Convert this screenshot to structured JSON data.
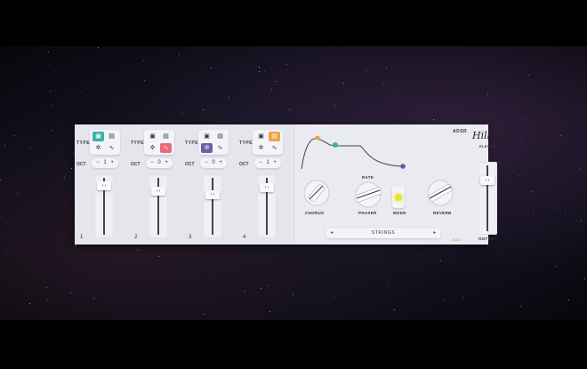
{
  "plugin": {
    "type_label": "TYPE",
    "oct_label": "OCT",
    "channels": [
      {
        "number": "1",
        "oct_value": "1",
        "type_selected_color": "#36b4a5",
        "oct_minus": "−",
        "oct_plus": "+"
      },
      {
        "number": "2",
        "oct_value": "0",
        "type_selected_color": "#e86b7a",
        "oct_minus": "−",
        "oct_plus": "+"
      },
      {
        "number": "3",
        "oct_value": "0",
        "type_selected_color": "#6d60a8",
        "oct_minus": "−",
        "oct_plus": "+"
      },
      {
        "number": "4",
        "oct_value": "1",
        "type_selected_color": "#f0a24a",
        "oct_minus": "−",
        "oct_plus": "+"
      }
    ],
    "adsr_label": "ADSR",
    "logo_script": "Hillman",
    "logo_sub": "ELEVNA",
    "knobs": {
      "chorus": "CHORUS",
      "phaser": "PHASER",
      "rate": "RATE",
      "mode": "MODE",
      "reverb": "REVERB"
    },
    "preset_name": "STRINGS",
    "prev_arrow": "◂",
    "next_arrow": "▸",
    "version": "v1.0.0",
    "output_label": "OUTPUT",
    "accent_teal": "#3bb3a4",
    "accent_purple": "#6d4fb0",
    "mode_led_color": "#e8e430"
  }
}
